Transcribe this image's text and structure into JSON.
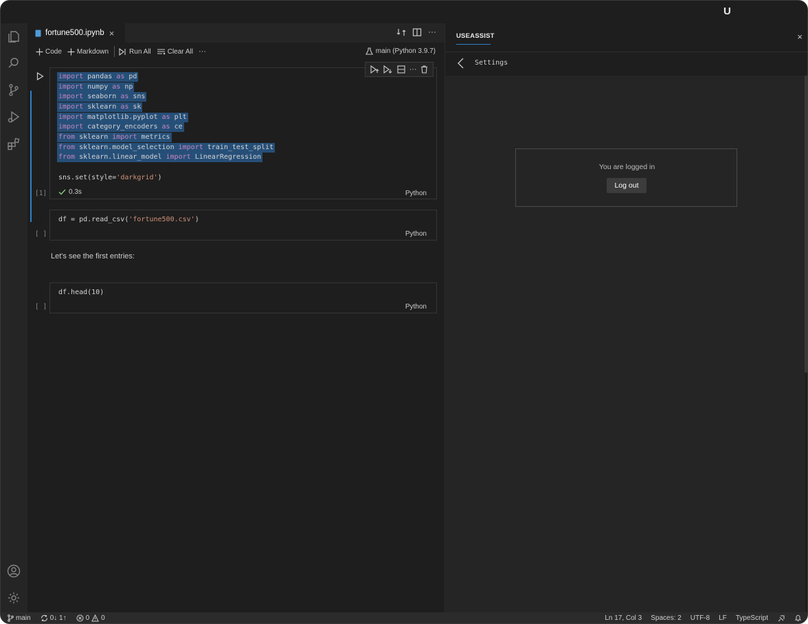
{
  "titlebar": {
    "logo": "U"
  },
  "activity": {
    "icons": [
      "files-icon",
      "search-icon",
      "source-control-icon",
      "run-debug-icon",
      "extensions-icon",
      "account-icon",
      "gear-icon"
    ]
  },
  "tab": {
    "label": "fortune500.ipynb",
    "close": "×"
  },
  "toolbar": {
    "code_label": "Code",
    "markdown_label": "Markdown",
    "run_all_label": "Run All",
    "clear_all_label": "Clear All",
    "more": "···",
    "kernel_label": "main (Python 3.9.7)"
  },
  "cells": [
    {
      "count": "[1]",
      "lang": "Python",
      "status": "0.3s",
      "lines": [
        {
          "kw1": "import",
          "t1": " pandas ",
          "kw2": "as",
          "t2": " pd"
        },
        {
          "kw1": "import",
          "t1": " numpy ",
          "kw2": "as",
          "t2": " np"
        },
        {
          "kw1": "import",
          "t1": " seaborn ",
          "kw2": "as",
          "t2": " sns"
        },
        {
          "kw1": "import",
          "t1": " sklearn ",
          "kw2": "as",
          "t2": " sk"
        },
        {
          "kw1": "import",
          "t1": " matplotlib.pyplot ",
          "kw2": "as",
          "t2": " plt"
        },
        {
          "kw1": "import",
          "t1": " category_encoders ",
          "kw2": "as",
          "t2": " ce"
        },
        {
          "kw1": "from",
          "t1": " sklearn ",
          "kw2": "import",
          "t2": " metrics"
        },
        {
          "kw1": "from",
          "t1": " sklearn.model_selection ",
          "kw2": "import",
          "t2": " train_test_split"
        },
        {
          "kw1": "from",
          "t1": " sklearn.linear_model ",
          "kw2": "import",
          "t2": " LinearRegression"
        }
      ],
      "last_line": {
        "pre": "sns.set(style=",
        "str": "'darkgrid'",
        "post": ")"
      }
    },
    {
      "count": "[ ]",
      "lang": "Python",
      "line": {
        "pre": "df = pd.read_csv(",
        "str": "'fortune500.csv'",
        "post": ")"
      }
    },
    {
      "count": "[ ]",
      "lang": "Python",
      "line": "df.head(10)"
    }
  ],
  "markdown": "Let's see the first entries:",
  "panel": {
    "title": "USEASSIST",
    "close": "×",
    "sub_label": "Settings",
    "logged_text": "You are logged in",
    "logout_label": "Log out"
  },
  "status": {
    "branch": "main",
    "sync": "0↓ 1↑",
    "errors": "0",
    "warnings": "0",
    "position": "Ln 17, Col 3",
    "spaces": "Spaces: 2",
    "encoding": "UTF-8",
    "eol": "LF",
    "language": "TypeScript"
  }
}
